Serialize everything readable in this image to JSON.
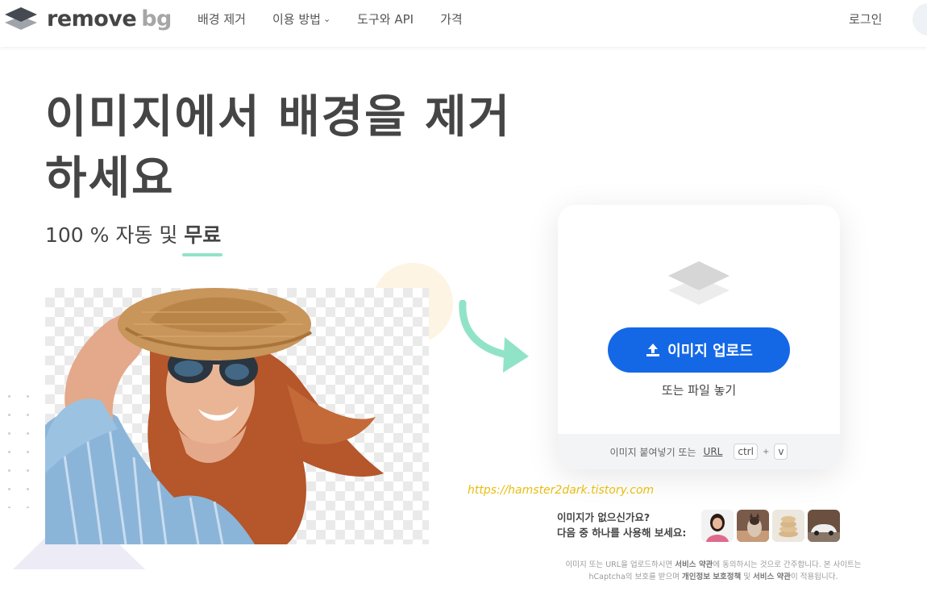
{
  "header": {
    "logo_main": "remove",
    "logo_accent": "bg",
    "nav": [
      {
        "label": "배경 제거"
      },
      {
        "label": "이용 방법",
        "has_dropdown": true
      },
      {
        "label": "도구와 API"
      },
      {
        "label": "가격"
      }
    ],
    "login_label": "로그인"
  },
  "hero": {
    "headline": "이미지에서 배경을 제거하세요",
    "subline_prefix": "100 % 자동 및 ",
    "subline_highlight": "무료"
  },
  "upload": {
    "button_label": "이미지 업로드",
    "drop_text": "또는 파일 놓기",
    "paste_text": "이미지 붙여넣기 또는",
    "url_label": "URL",
    "key_ctrl": "ctrl",
    "key_plus": "+",
    "key_v": "v"
  },
  "watermark": "https://hamster2dark.tistory.com",
  "samples": {
    "line1": "이미지가 없으신가요?",
    "line2": "다음 중 하나를 사용해 보세요:",
    "items": [
      "woman-sample",
      "cat-sample",
      "food-sample",
      "car-sample"
    ]
  },
  "legal": {
    "part1": "이미지 또는 URL을 업로드하시면 ",
    "terms": "서비스 약관",
    "part2": "에 동의하시는 것으로 간주합니다. 본 사이트는 hCaptcha의 보호를 받으며 ",
    "privacy": "개인정보 보호정책",
    "part3": " 및 ",
    "terms2": "서비스 약관",
    "part4": "이 적용됩니다."
  },
  "colors": {
    "primary_button": "#1468e6",
    "accent_underline": "#91e3c8",
    "arrow": "#91e3c8",
    "watermark": "#e8bd10"
  }
}
